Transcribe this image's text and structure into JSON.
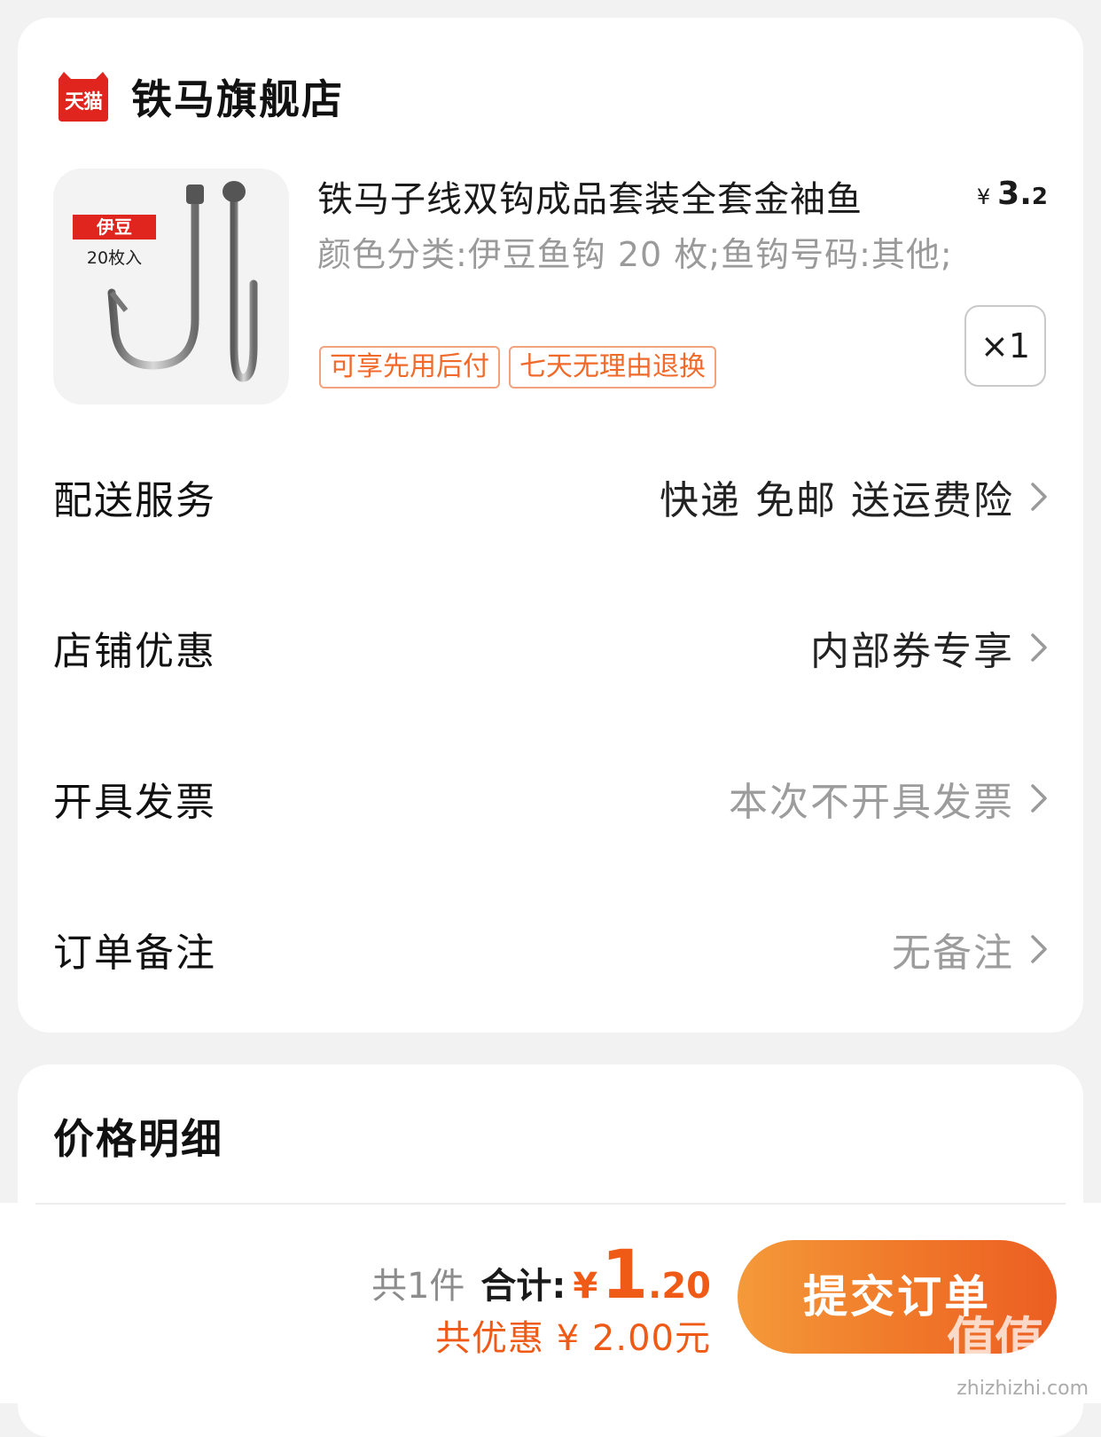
{
  "store": {
    "logo_text": "天猫",
    "name": "铁马旗舰店"
  },
  "product": {
    "thumb_badge": "伊豆",
    "thumb_sub": "20枚入",
    "title": "铁马子线双钩成品套装全套金袖鱼",
    "price_yen": "¥",
    "price_int": "3.",
    "price_dec": "2",
    "spec": "颜色分类:伊豆鱼钩 20 枚;鱼钩号码:其他;",
    "tags": [
      "可享先用后付",
      "七天无理由退换"
    ],
    "quantity": "×1"
  },
  "rows": [
    {
      "label": "配送服务",
      "value": "快递 免邮 送运费险"
    },
    {
      "label": "店铺优惠",
      "value": "内部券专享"
    },
    {
      "label": "开具发票",
      "value": "本次不开具发票"
    },
    {
      "label": "订单备注",
      "value": "无备注"
    }
  ],
  "price_detail": {
    "title": "价格明细"
  },
  "summary": {
    "count_text": "共1件",
    "total_label": "合计:",
    "total_yen": "¥",
    "total_int": "1",
    "total_dec": ".20",
    "discount_text": "共优惠 ¥ 2.00元"
  },
  "submit_button": "提交订单",
  "watermark": {
    "text": "值值值",
    "sub": "zhizhizhi.com"
  },
  "colors": {
    "accent": "#f05a17",
    "tag_text": "#f06a2a",
    "tmall_red": "#e0251f"
  }
}
